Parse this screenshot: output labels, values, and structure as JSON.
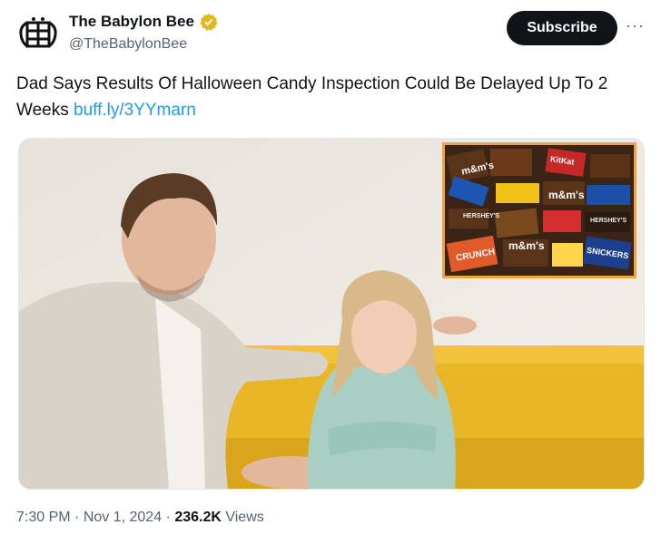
{
  "header": {
    "display_name": "The Babylon Bee",
    "handle": "@TheBabylonBee",
    "verified_icon": "verified-badge-icon",
    "subscribe_label": "Subscribe",
    "more_label": "···"
  },
  "tweet": {
    "text": "Dad Says Results Of Halloween Candy Inspection Could Be Delayed Up To 2 Weeks ",
    "link": "buff.ly/3YYmarn"
  },
  "media": {
    "inset_text": {
      "mm1": "m&m's",
      "mm2": "m&m's",
      "mm3": "m&m's",
      "hershey1": "HERSHEY'S",
      "hershey2": "HERSHEY'S",
      "crunch": "CRUNCH",
      "snickers": "SNICKERS",
      "kitkat": "KitKat"
    }
  },
  "footer": {
    "time": "7:30 PM",
    "sep1": " · ",
    "date": "Nov 1, 2024",
    "sep2": " · ",
    "views_count": "236.2K",
    "views_label": " Views"
  },
  "colors": {
    "accent": "#1d9bf0",
    "verified": "#e2b719",
    "inset_border": "#f2a341",
    "couch": "#e8b626"
  }
}
